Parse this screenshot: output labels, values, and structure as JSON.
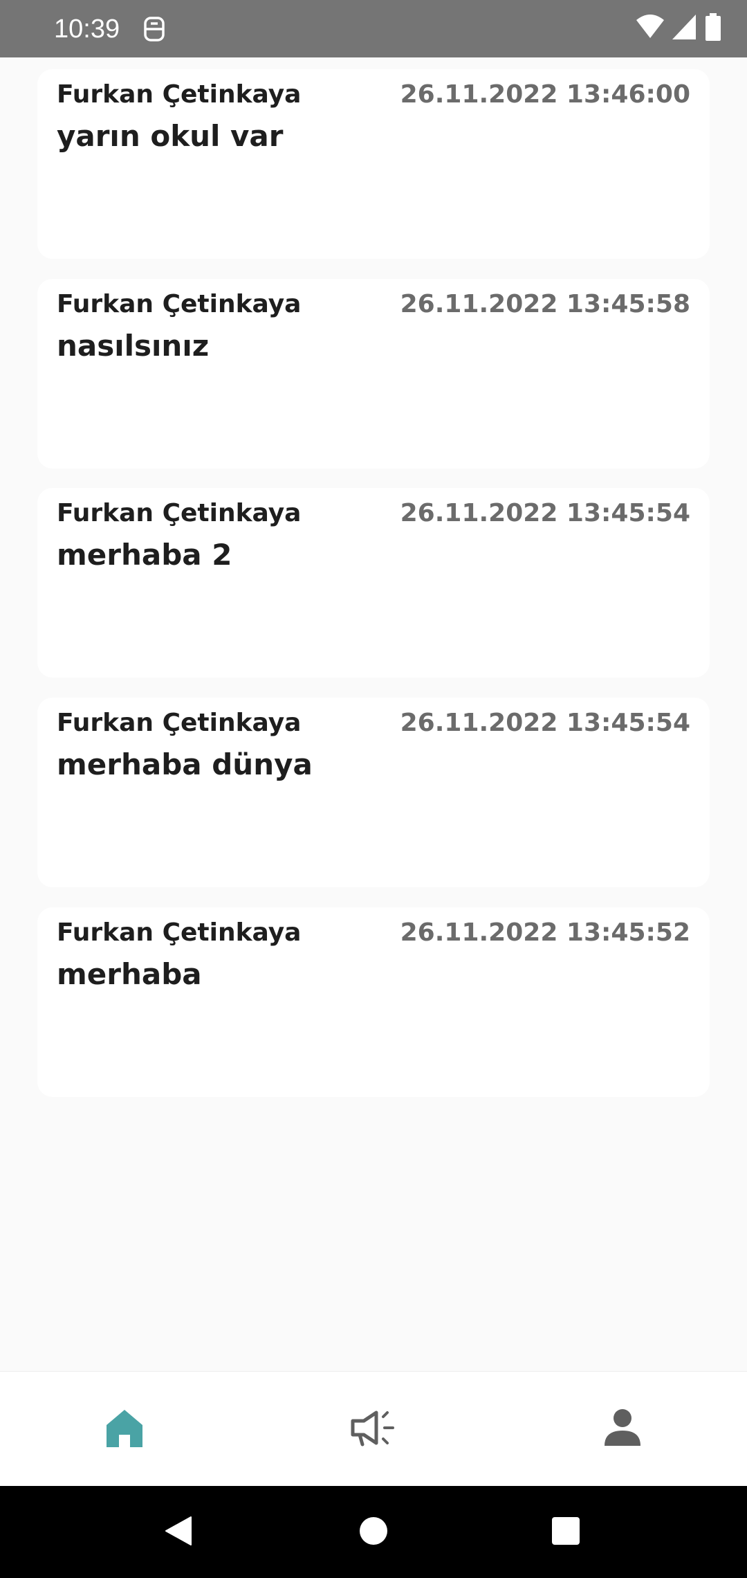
{
  "status_bar": {
    "time": "10:39",
    "icons": [
      "app-notification-icon",
      "wifi-icon",
      "cellular-signal-icon",
      "battery-icon"
    ]
  },
  "feed": {
    "posts": [
      {
        "author": "Furkan Çetinkaya",
        "timestamp": "26.11.2022 13:46:00",
        "message": "yarın okul var"
      },
      {
        "author": "Furkan Çetinkaya",
        "timestamp": "26.11.2022 13:45:58",
        "message": "nasılsınız"
      },
      {
        "author": "Furkan Çetinkaya",
        "timestamp": "26.11.2022 13:45:54",
        "message": "merhaba 2"
      },
      {
        "author": "Furkan Çetinkaya",
        "timestamp": "26.11.2022 13:45:54",
        "message": "merhaba dünya"
      },
      {
        "author": "Furkan Çetinkaya",
        "timestamp": "26.11.2022 13:45:52",
        "message": "merhaba"
      }
    ]
  },
  "bottom_nav": {
    "items": [
      {
        "icon": "home-icon",
        "active": true
      },
      {
        "icon": "megaphone-icon",
        "active": false
      },
      {
        "icon": "person-icon",
        "active": false
      }
    ],
    "active_color": "#4aa3a5",
    "inactive_color": "#5f5f5f"
  },
  "system_nav": {
    "buttons": [
      "back-icon",
      "home-circle-icon",
      "recents-icon"
    ]
  },
  "colors": {
    "status_bar": "#757575",
    "background": "#fafafa",
    "card": "#ffffff",
    "author_text": "#1e1e1e",
    "timestamp_text": "#6b6b6b"
  }
}
